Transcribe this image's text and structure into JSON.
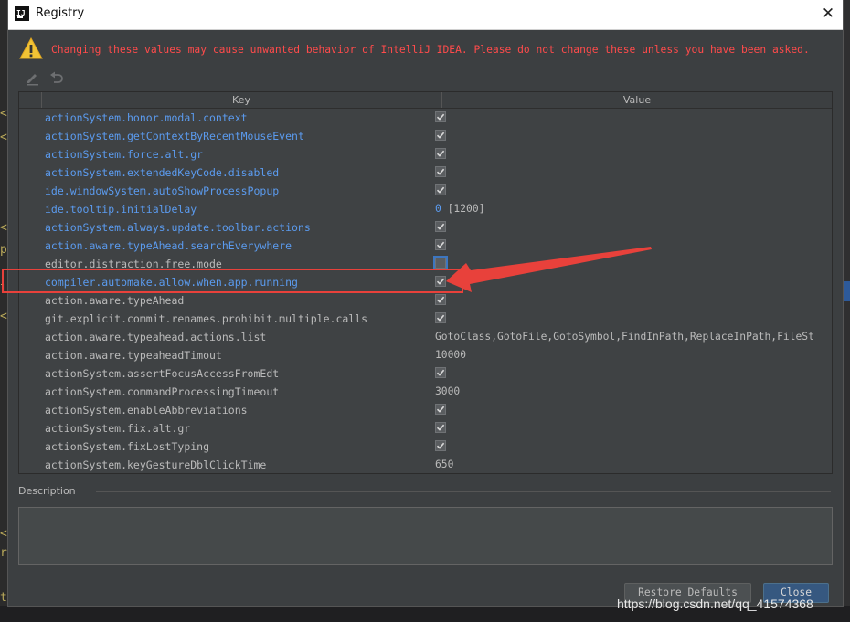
{
  "window": {
    "title": "Registry"
  },
  "warning": {
    "text": "Changing these values may cause unwanted behavior of IntelliJ IDEA. Please do not change these unless you have been asked."
  },
  "table": {
    "headers": {
      "key": "Key",
      "value": "Value"
    },
    "rows": [
      {
        "key": "actionSystem.honor.modal.context",
        "type": "checkbox",
        "checked": true,
        "changed": true
      },
      {
        "key": "actionSystem.getContextByRecentMouseEvent",
        "type": "checkbox",
        "checked": true,
        "changed": true
      },
      {
        "key": "actionSystem.force.alt.gr",
        "type": "checkbox",
        "checked": true,
        "changed": true
      },
      {
        "key": "actionSystem.extendedKeyCode.disabled",
        "type": "checkbox",
        "checked": true,
        "changed": true
      },
      {
        "key": "ide.windowSystem.autoShowProcessPopup",
        "type": "checkbox",
        "checked": true,
        "changed": true
      },
      {
        "key": "ide.tooltip.initialDelay",
        "type": "text",
        "value": "0",
        "default": "[1200]",
        "changed": true
      },
      {
        "key": "actionSystem.always.update.toolbar.actions",
        "type": "checkbox",
        "checked": true,
        "changed": true
      },
      {
        "key": "action.aware.typeAhead.searchEverywhere",
        "type": "checkbox",
        "checked": true,
        "changed": true
      },
      {
        "key": "editor.distraction.free.mode",
        "type": "checkbox",
        "checked": false,
        "changed": false,
        "focused": true
      },
      {
        "key": "compiler.automake.allow.when.app.running",
        "type": "checkbox",
        "checked": true,
        "changed": true
      },
      {
        "key": "action.aware.typeAhead",
        "type": "checkbox",
        "checked": true,
        "changed": false
      },
      {
        "key": "git.explicit.commit.renames.prohibit.multiple.calls",
        "type": "checkbox",
        "checked": true,
        "changed": false
      },
      {
        "key": "action.aware.typeahead.actions.list",
        "type": "text",
        "value": "GotoClass,GotoFile,GotoSymbol,FindInPath,ReplaceInPath,FileSt",
        "changed": false
      },
      {
        "key": "action.aware.typeaheadTimout",
        "type": "text",
        "value": "10000",
        "changed": false
      },
      {
        "key": "actionSystem.assertFocusAccessFromEdt",
        "type": "checkbox",
        "checked": true,
        "changed": false
      },
      {
        "key": "actionSystem.commandProcessingTimeout",
        "type": "text",
        "value": "3000",
        "changed": false
      },
      {
        "key": "actionSystem.enableAbbreviations",
        "type": "checkbox",
        "checked": true,
        "changed": false
      },
      {
        "key": "actionSystem.fix.alt.gr",
        "type": "checkbox",
        "checked": true,
        "changed": false
      },
      {
        "key": "actionSystem.fixLostTyping",
        "type": "checkbox",
        "checked": true,
        "changed": false
      },
      {
        "key": "actionSystem.keyGestureDblClickTime",
        "type": "text",
        "value": "650",
        "changed": false
      }
    ]
  },
  "description": {
    "label": "Description",
    "text": ""
  },
  "buttons": {
    "restore": "Restore Defaults",
    "close": "Close"
  },
  "watermark": "https://blog.csdn.net/qq_41574368",
  "gutter": [
    "<",
    "<",
    "<",
    "p",
    "l",
    "<",
    "<",
    "ri",
    "t"
  ],
  "colors": {
    "changed_key": "#5b9bef",
    "warning": "#ff4b4b",
    "annotation": "#e8413b",
    "primary_button": "#365880"
  }
}
